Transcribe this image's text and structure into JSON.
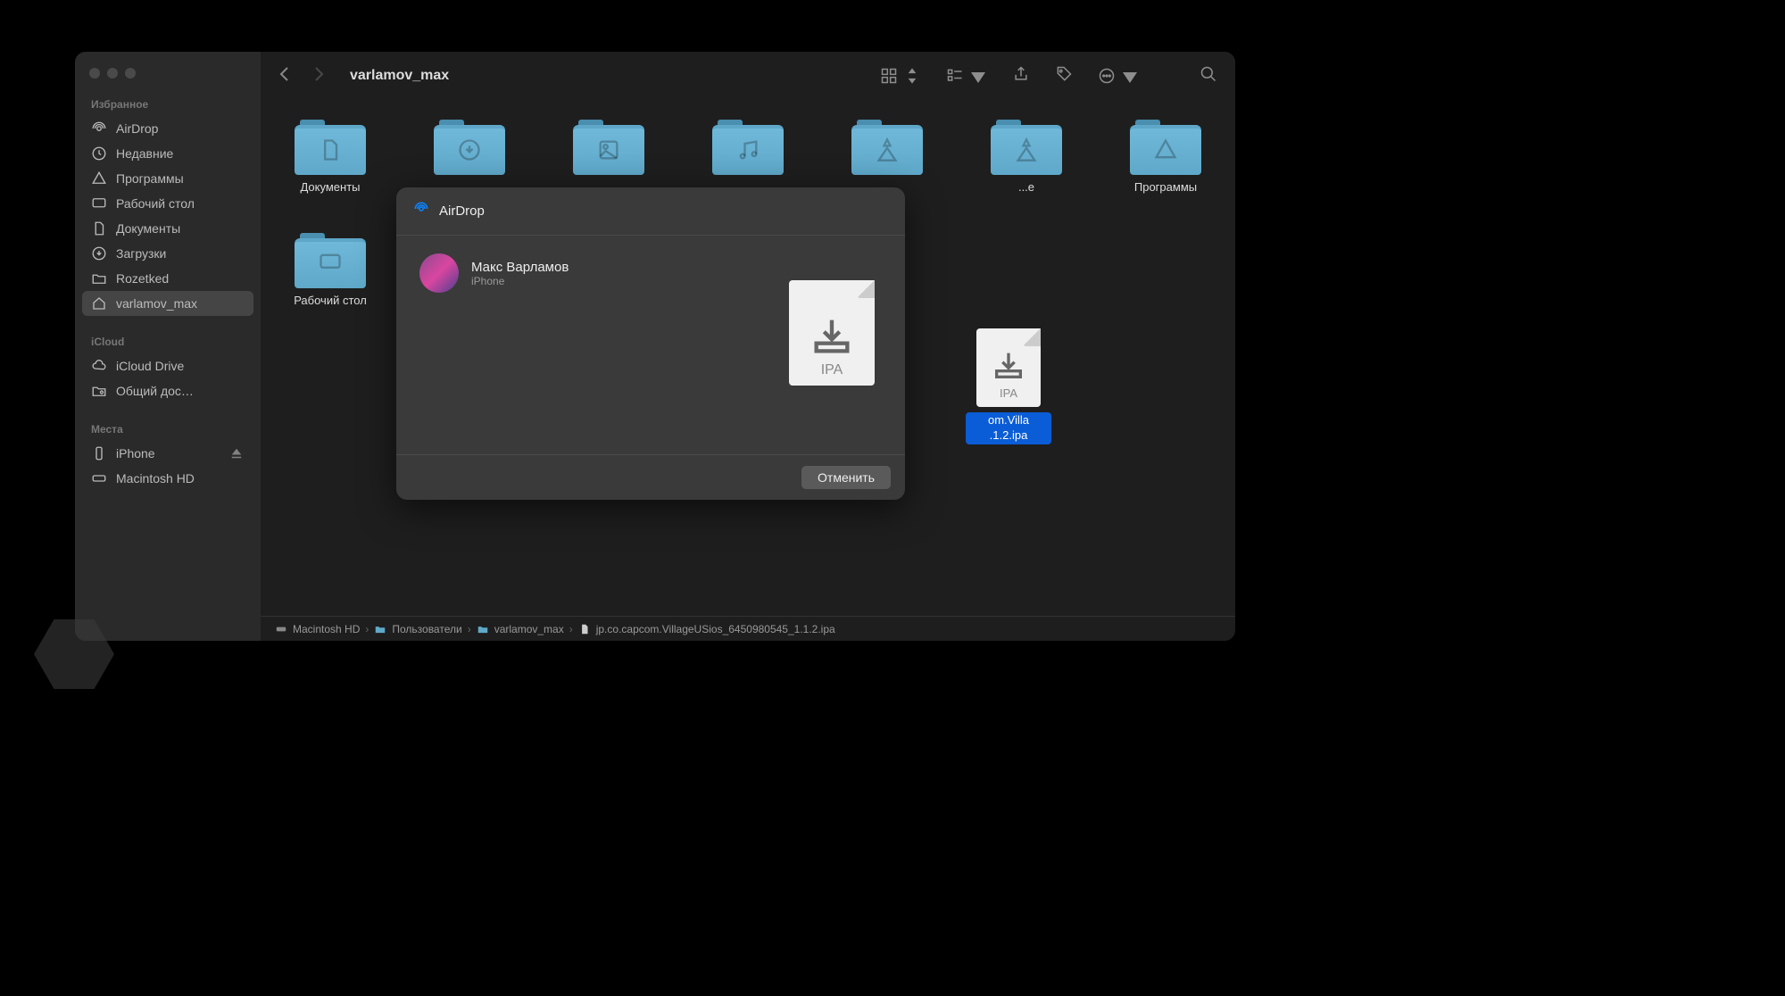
{
  "window": {
    "title": "varlamov_max"
  },
  "sidebar": {
    "sections": [
      {
        "header": "Избранное",
        "items": [
          {
            "icon": "airdrop",
            "label": "AirDrop"
          },
          {
            "icon": "clock",
            "label": "Недавние"
          },
          {
            "icon": "apps",
            "label": "Программы"
          },
          {
            "icon": "desktop",
            "label": "Рабочий стол"
          },
          {
            "icon": "document",
            "label": "Документы"
          },
          {
            "icon": "download",
            "label": "Загрузки"
          },
          {
            "icon": "folder",
            "label": "Rozetked"
          },
          {
            "icon": "home",
            "label": "varlamov_max",
            "active": true
          }
        ]
      },
      {
        "header": "iCloud",
        "items": [
          {
            "icon": "cloud",
            "label": "iCloud Drive"
          },
          {
            "icon": "shared",
            "label": "Общий дос…"
          }
        ]
      },
      {
        "header": "Места",
        "items": [
          {
            "icon": "device",
            "label": "iPhone",
            "eject": true
          },
          {
            "icon": "disk",
            "label": "Macintosh HD"
          }
        ]
      }
    ]
  },
  "files": [
    {
      "type": "folder",
      "glyph": "document",
      "label": "Документы"
    },
    {
      "type": "folder",
      "glyph": "download",
      "label": ""
    },
    {
      "type": "folder",
      "glyph": "image",
      "label": ""
    },
    {
      "type": "folder",
      "glyph": "music",
      "label": ""
    },
    {
      "type": "folder",
      "glyph": "public",
      "label": ""
    },
    {
      "type": "folder",
      "glyph": "public",
      "label": "...е"
    },
    {
      "type": "folder",
      "glyph": "apps",
      "label": "Программы"
    },
    {
      "type": "folder",
      "glyph": "desktop",
      "label": "Рабочий стол"
    },
    {
      "type": "ipa",
      "label": "om.Villa .1.2.ipa",
      "selected": true,
      "ext": "IPA"
    }
  ],
  "pathbar": [
    {
      "icon": "disk",
      "label": "Macintosh HD"
    },
    {
      "icon": "folder",
      "label": "Пользователи"
    },
    {
      "icon": "folder",
      "label": "varlamov_max"
    },
    {
      "icon": "file",
      "label": "jp.co.capcom.VillageUSios_6450980545_1.1.2.ipa"
    }
  ],
  "airdrop": {
    "title": "AirDrop",
    "recipient": {
      "name": "Макс Варламов",
      "device": "iPhone"
    },
    "file_ext": "IPA",
    "cancel": "Отменить"
  }
}
